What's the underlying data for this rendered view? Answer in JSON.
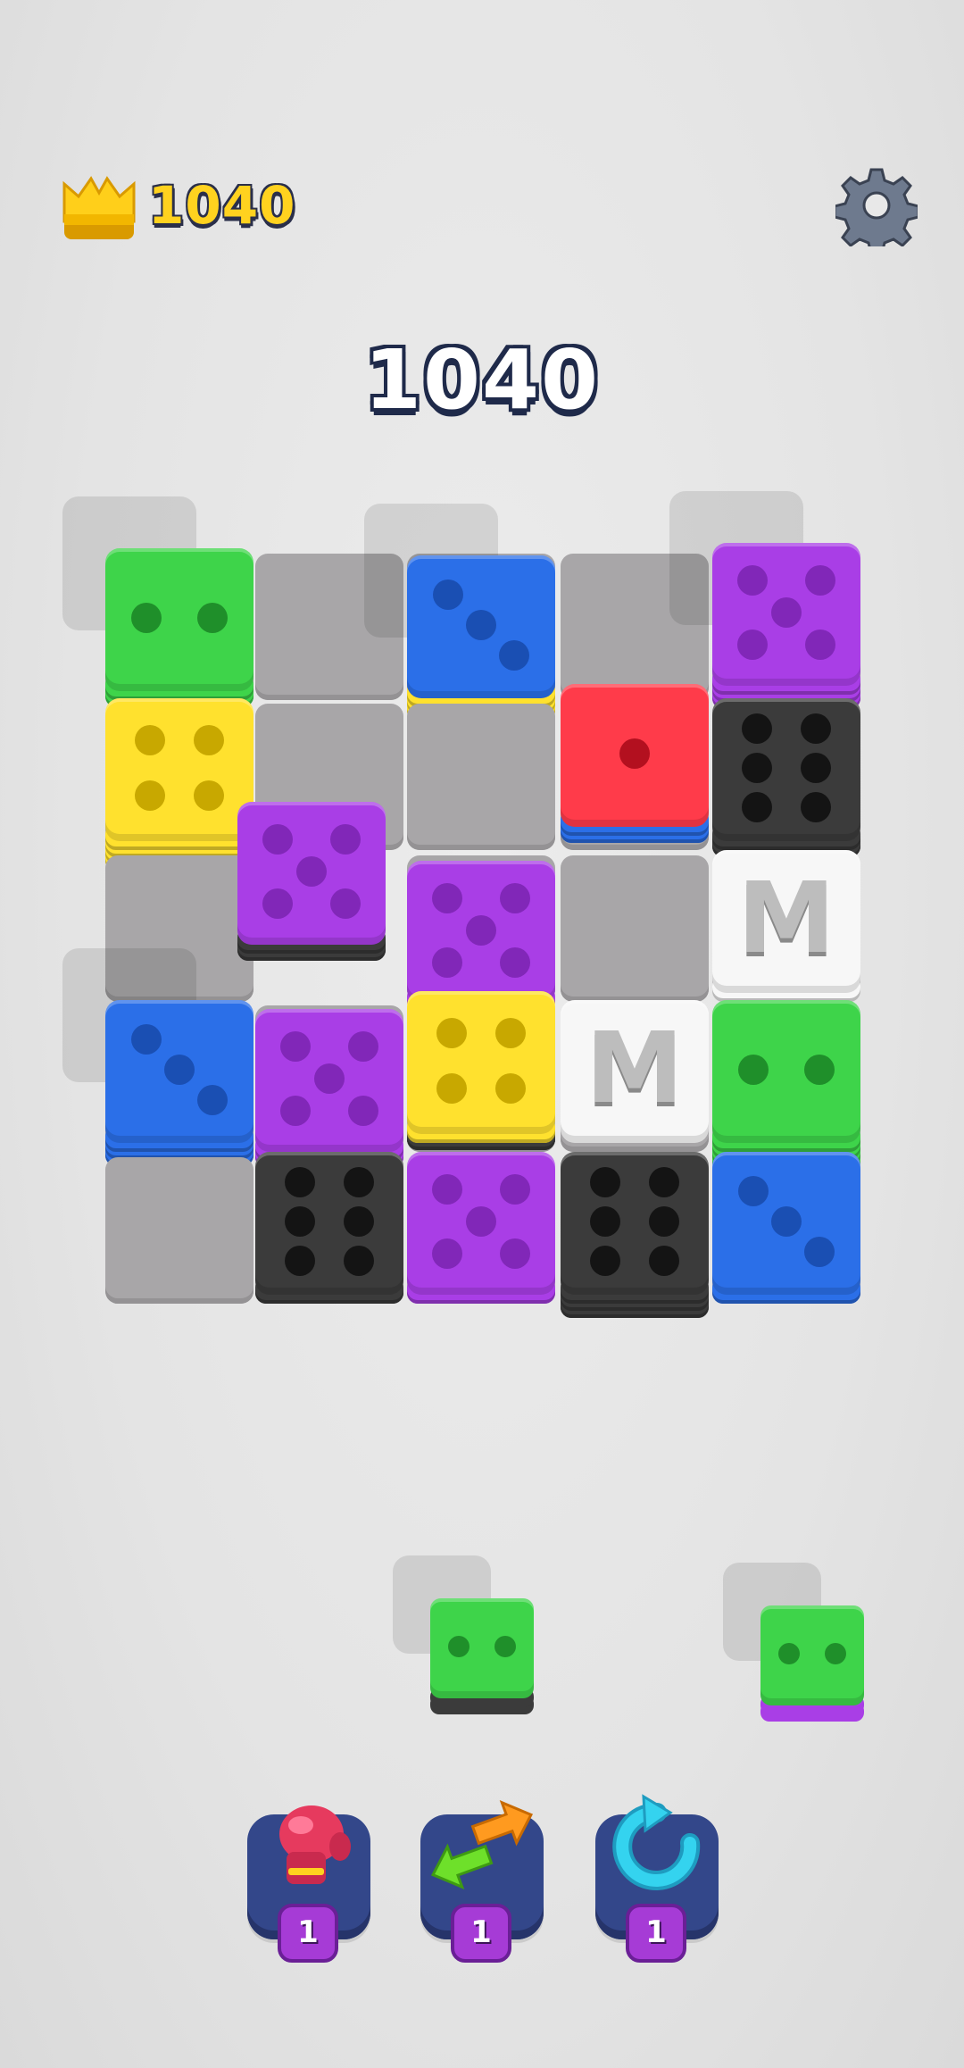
{
  "hud": {
    "coins": "1040",
    "crown_icon": "crown-icon",
    "settings_icon": "gear-icon"
  },
  "score": "1040",
  "palette": {
    "green": "#3ed44a",
    "blue": "#2b6fe8",
    "purple": "#a93ee6",
    "yellow": "#ffe12e",
    "red": "#ff3b4a",
    "black": "#3b3b3b",
    "white": "#f7f7f7",
    "empty": "#a8a6a8"
  },
  "board": {
    "rows": [
      [
        "green-2",
        "empty",
        "blue-3",
        "empty",
        "purple-5"
      ],
      [
        "yellow-4",
        "empty",
        "empty",
        "red-1",
        "black-6"
      ],
      [
        "empty",
        "purple-5",
        "purple-5",
        "empty",
        "white-M"
      ],
      [
        "blue-3",
        "purple-5",
        "yellow-4",
        "white-M",
        "green-2"
      ],
      [
        "empty",
        "black-6",
        "purple-5",
        "black-6",
        "blue-3"
      ]
    ],
    "special_tile_letter": "M"
  },
  "next_pieces": [
    {
      "top": "green-2",
      "base": "black"
    },
    {
      "top": "green-2",
      "base": "purple"
    }
  ],
  "boosters": [
    {
      "name": "boxing-glove",
      "count": "1"
    },
    {
      "name": "swap",
      "count": "1"
    },
    {
      "name": "refresh",
      "count": "1"
    }
  ]
}
